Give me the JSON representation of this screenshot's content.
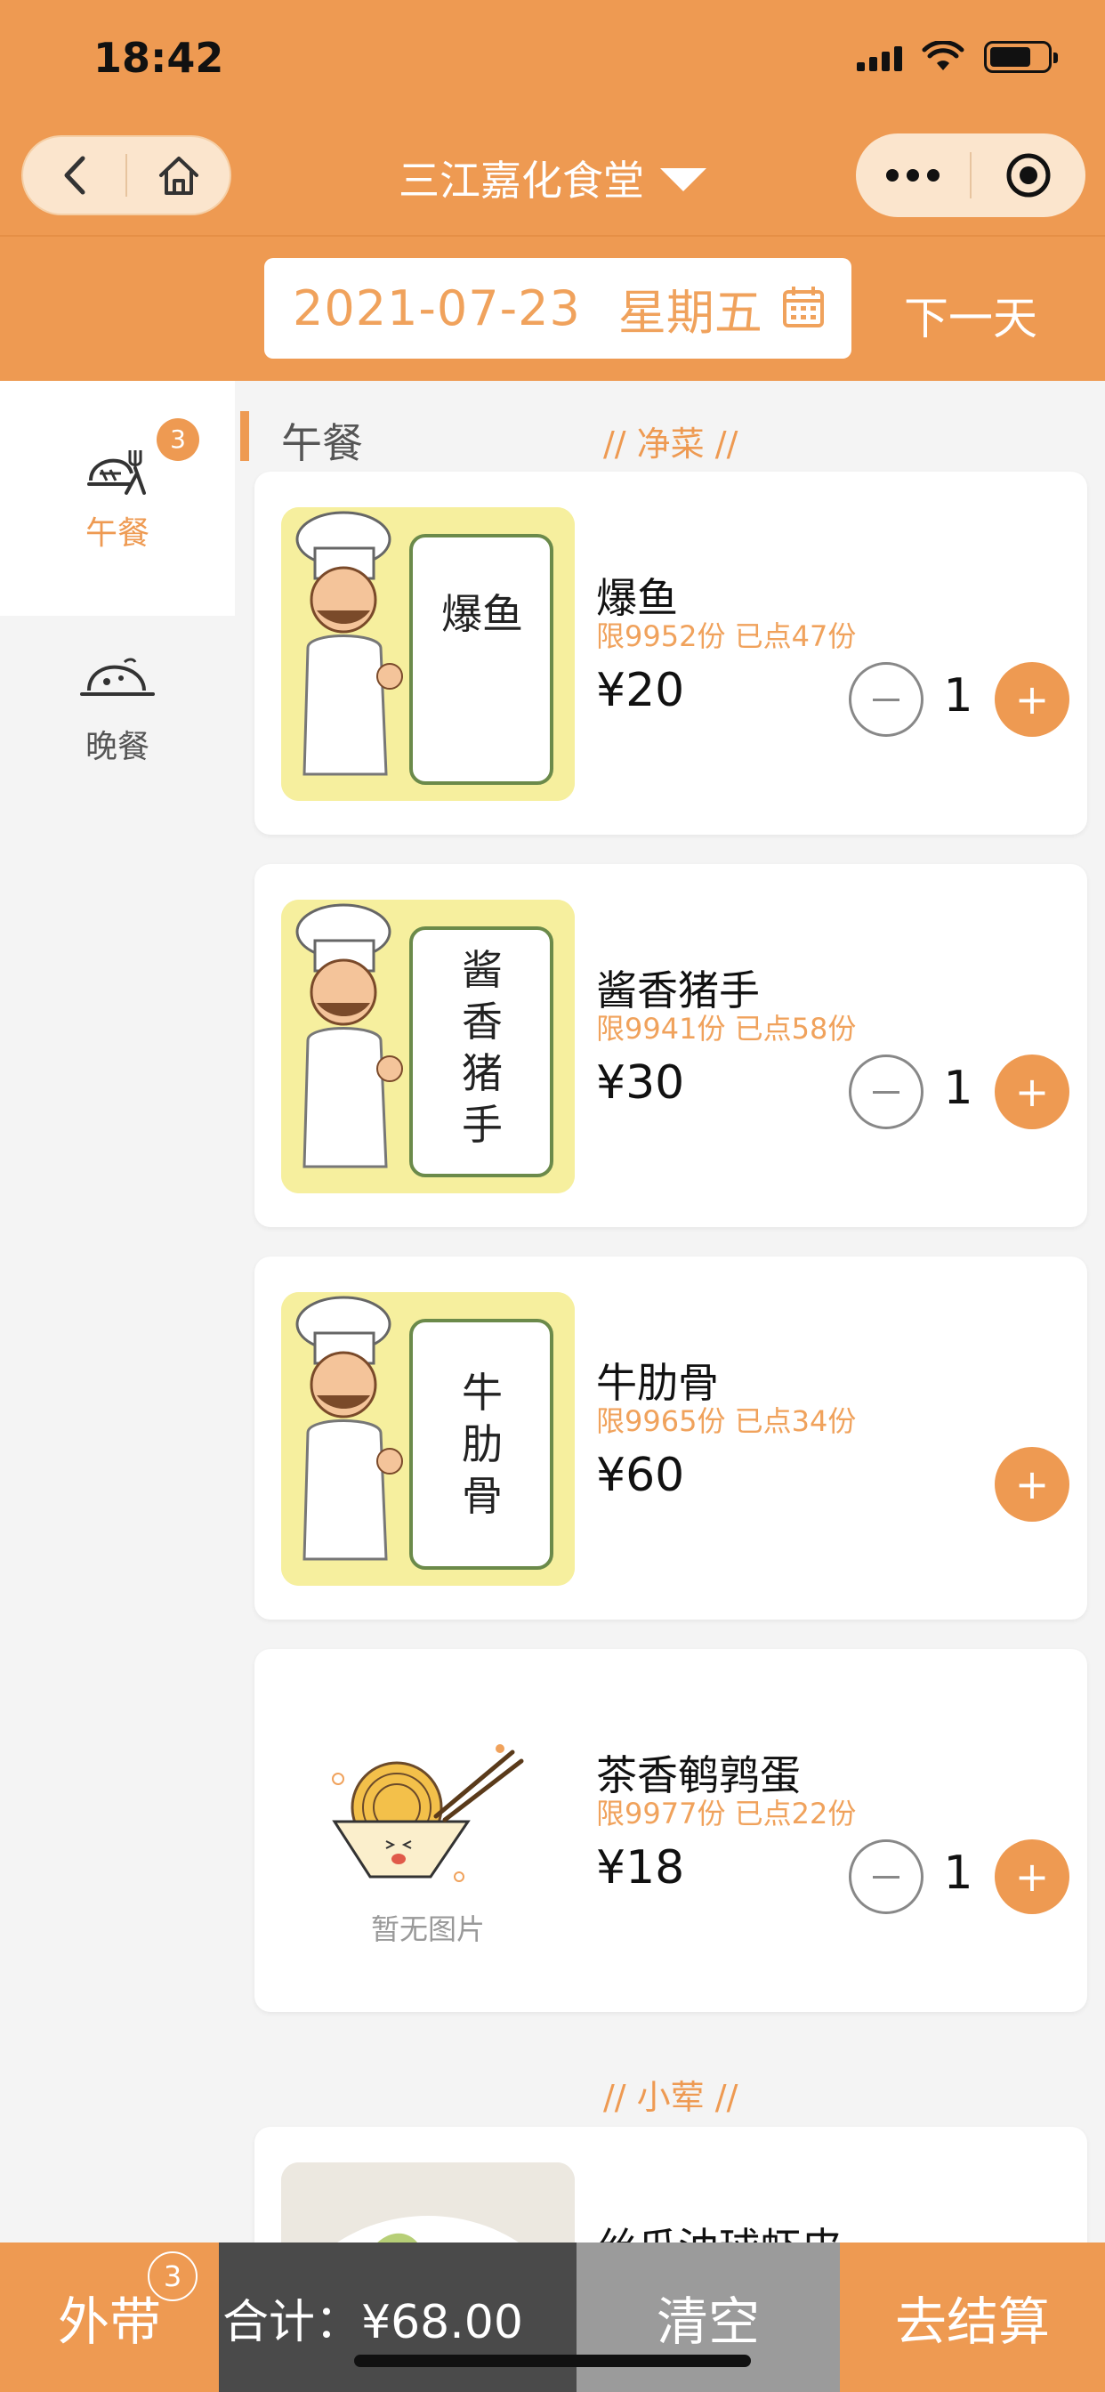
{
  "status": {
    "time": "18:42"
  },
  "nav": {
    "title": "三江嘉化食堂"
  },
  "date": {
    "value": "2021-07-23",
    "weekday": "星期五",
    "next_label": "下一天"
  },
  "sidebar": {
    "items": [
      {
        "label": "午餐",
        "badge": "3",
        "icon": "lunch-icon",
        "active": true
      },
      {
        "label": "晚餐",
        "icon": "dinner-icon",
        "active": false
      }
    ]
  },
  "section": {
    "title": "午餐"
  },
  "groups": [
    {
      "label": "// 净菜 //"
    },
    {
      "label": "// 小荤 //"
    }
  ],
  "dishes": [
    {
      "name": "爆鱼",
      "image_text": "爆鱼",
      "quota": "限9952份",
      "ordered": "已点47份",
      "price": "¥20",
      "qty": "1"
    },
    {
      "name": "酱香猪手",
      "image_text": "酱香猪手",
      "quota": "限9941份",
      "ordered": "已点58份",
      "price": "¥30",
      "qty": "1"
    },
    {
      "name": "牛肋骨",
      "image_text": "牛肋骨",
      "quota": "限9965份",
      "ordered": "已点34份",
      "price": "¥60",
      "qty": ""
    },
    {
      "name": "茶香鹌鹑蛋",
      "image_text": "暂无图片",
      "quota": "限9977份",
      "ordered": "已点22份",
      "price": "¥18",
      "qty": "1"
    },
    {
      "name": "丝瓜油球虾皮"
    }
  ],
  "bottom": {
    "takeout_label": "外带",
    "takeout_badge": "3",
    "total_label": "合计：¥68.00",
    "clear_label": "清空",
    "checkout_label": "去结算"
  },
  "colors": {
    "accent": "#ee9a52",
    "accent_text": "#f0a25c",
    "dark": "#4a4a4a",
    "grey": "#9b9b9b"
  }
}
